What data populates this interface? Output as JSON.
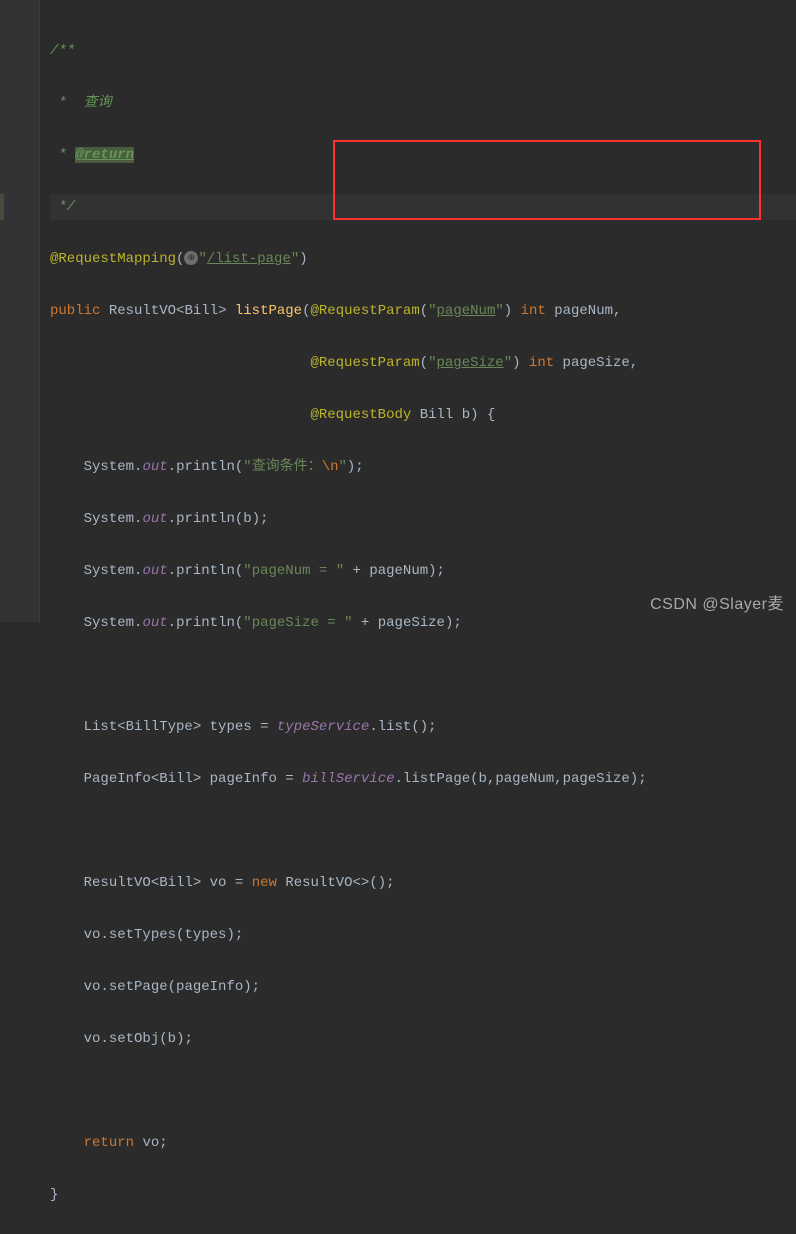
{
  "doc": {
    "start": "/**",
    "line1": " *  查询",
    "line2_prefix": " * ",
    "return_tag": "@return",
    "end": " */"
  },
  "annotation": {
    "request_mapping": "@RequestMapping",
    "request_param": "@RequestParam",
    "request_body": "@RequestBody"
  },
  "strings": {
    "list_page": "/list-page",
    "page_num": "pageNum",
    "page_size": "pageSize",
    "query_cond": "查询条件：",
    "newline": "\\n",
    "pagenum_eq": "pageNum = ",
    "pagesize_eq": "pageSize = "
  },
  "keywords": {
    "public": "public",
    "int": "int",
    "new": "new",
    "return": "return"
  },
  "identifiers": {
    "resultvo": "ResultVO",
    "bill": "Bill",
    "list_page_method": "listPage",
    "page_num_var": "pageNum",
    "page_size_var": "pageSize",
    "b": "b",
    "system": "System",
    "out": "out",
    "println": "println",
    "list": "List",
    "billtype": "BillType",
    "types": "types",
    "type_service": "typeService",
    "list_method": "list",
    "pageinfo": "PageInfo",
    "page_info_var": "pageInfo",
    "bill_service": "billService",
    "list_page_call": "listPage",
    "vo": "vo",
    "set_types": "setTypes",
    "set_page": "setPage",
    "set_obj": "setObj"
  },
  "watermark": "CSDN @Slayer麦"
}
